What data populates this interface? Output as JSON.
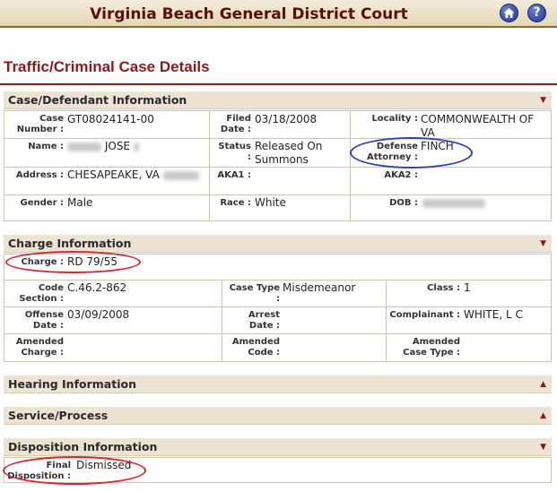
{
  "header": {
    "title": "Virginia Beach General District Court",
    "home_icon": "home-icon",
    "help_icon": "help-icon"
  },
  "page": {
    "title": "Traffic/Criminal Case Details"
  },
  "case_defendant": {
    "heading": "Case/Defendant Information",
    "case_number_label": "Case Number :",
    "case_number": "GT08024141-00",
    "filed_label": "Filed Date :",
    "filed": "03/18/2008",
    "locality_label": "Locality :",
    "locality": "COMMONWEALTH OF VA",
    "name_label": "Name :",
    "name": "JOSE",
    "status_label": "Status :",
    "status": "Released On Summons",
    "defense_label": "Defense Attorney :",
    "defense": "FINCH",
    "address_label": "Address :",
    "address": "CHESAPEAKE, VA",
    "aka1_label": "AKA1 :",
    "aka2_label": "AKA2 :",
    "gender_label": "Gender :",
    "gender": "Male",
    "race_label": "Race :",
    "race": "White",
    "dob_label": "DOB :"
  },
  "charge": {
    "heading": "Charge Information",
    "charge_label": "Charge :",
    "charge": "RD 79/55",
    "code_label": "Code Section :",
    "code": "C.46.2-862",
    "case_type_label": "Case Type :",
    "case_type": "Misdemeanor",
    "class_label": "Class :",
    "class": "1",
    "offense_label": "Offense Date :",
    "offense": "03/09/2008",
    "arrest_label": "Arrest Date :",
    "complainant_label": "Complainant :",
    "complainant": "WHITE, L C",
    "amended_charge_label": "Amended Charge :",
    "amended_code_label": "Amended Code :",
    "amended_type_label": "Amended Case Type :"
  },
  "hearing": {
    "heading": "Hearing Information"
  },
  "service": {
    "heading": "Service/Process"
  },
  "disposition": {
    "heading": "Disposition Information",
    "final_label": "Final Disposition :",
    "final": "Dismissed"
  },
  "colors": {
    "accent": "#8b1a1a",
    "header_text": "#5a0f0f",
    "annotation_red": "#d6262f",
    "annotation_blue": "#2e3fb4"
  }
}
